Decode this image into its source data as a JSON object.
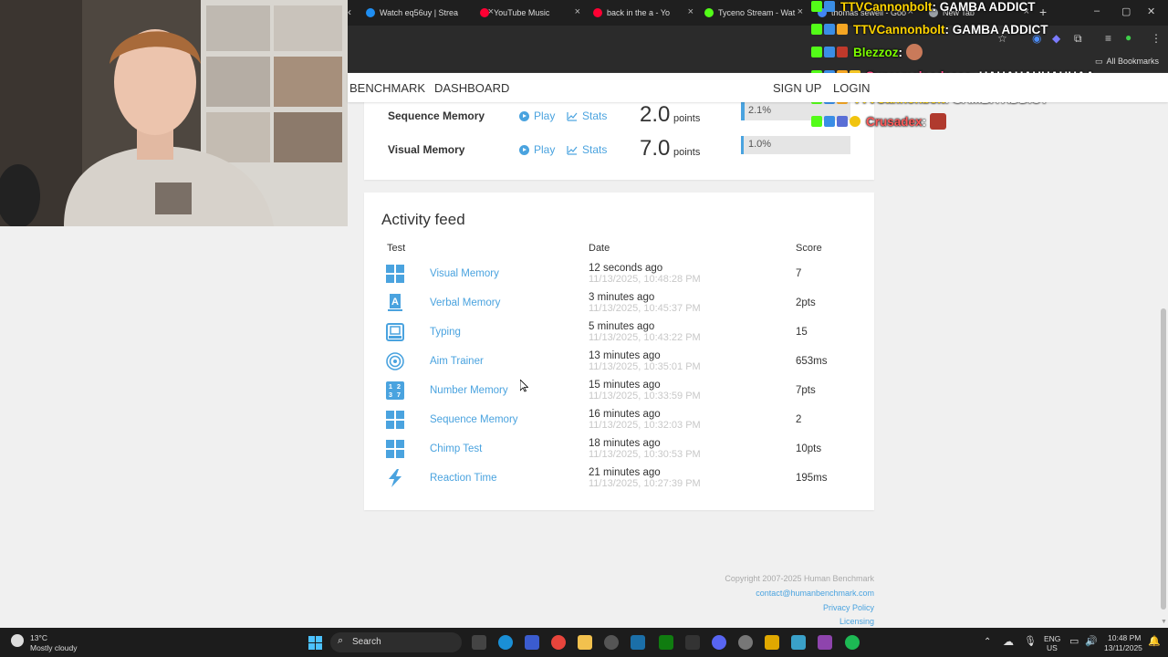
{
  "browser": {
    "tabs": [
      {
        "title": "Watch eq56uy | Strea",
        "color": "#1f8ef1"
      },
      {
        "title": "YouTube Music",
        "color": "#ff0033"
      },
      {
        "title": "back in the a - Yo",
        "color": "#ff0033"
      },
      {
        "title": "Tyceno Stream - Wat",
        "color": "#53fc18"
      },
      {
        "title": "thomas sewell - Goo",
        "color": "#4285f4"
      },
      {
        "title": "New Tab",
        "color": "#9aa0a6"
      }
    ],
    "bookmarks_label": "All Bookmarks",
    "new_tab_symbol": "+"
  },
  "site": {
    "nav": {
      "benchmark": "BENCHMARK",
      "dashboard": "DASHBOARD",
      "signup": "SIGN UP",
      "login": "LOGIN"
    },
    "stats_rows": [
      {
        "name": "Sequence Memory",
        "play": "Play",
        "stats": "Stats",
        "points": "2.0",
        "points_label": "points",
        "percentile": "2.1%",
        "percentile_value": 2.1
      },
      {
        "name": "Visual Memory",
        "play": "Play",
        "stats": "Stats",
        "points": "7.0",
        "points_label": "points",
        "percentile": "1.0%",
        "percentile_value": 1.0
      }
    ],
    "activity": {
      "title": "Activity feed",
      "headers": {
        "test": "Test",
        "date": "Date",
        "score": "Score"
      },
      "rows": [
        {
          "icon": "grid-icon",
          "test": "Visual Memory",
          "ago": "12 seconds ago",
          "timestamp": "11/13/2025, 10:48:28 PM",
          "score": "7"
        },
        {
          "icon": "letter-a-icon",
          "test": "Verbal Memory",
          "ago": "3 minutes ago",
          "timestamp": "11/13/2025, 10:45:37 PM",
          "score": "2pts"
        },
        {
          "icon": "keyboard-icon",
          "test": "Typing",
          "ago": "5 minutes ago",
          "timestamp": "11/13/2025, 10:43:22 PM",
          "score": "15"
        },
        {
          "icon": "target-icon",
          "test": "Aim Trainer",
          "ago": "13 minutes ago",
          "timestamp": "11/13/2025, 10:35:01 PM",
          "score": "653ms"
        },
        {
          "icon": "numbers-icon",
          "test": "Number Memory",
          "ago": "15 minutes ago",
          "timestamp": "11/13/2025, 10:33:59 PM",
          "score": "7pts"
        },
        {
          "icon": "grid-icon",
          "test": "Sequence Memory",
          "ago": "16 minutes ago",
          "timestamp": "11/13/2025, 10:32:03 PM",
          "score": "2"
        },
        {
          "icon": "grid-icon",
          "test": "Chimp Test",
          "ago": "18 minutes ago",
          "timestamp": "11/13/2025, 10:30:53 PM",
          "score": "10pts"
        },
        {
          "icon": "lightning-icon",
          "test": "Reaction Time",
          "ago": "21 minutes ago",
          "timestamp": "11/13/2025, 10:27:39 PM",
          "score": "195ms"
        }
      ]
    },
    "footer": {
      "copyright": "Copyright 2007-2025 Human Benchmark",
      "contact": "contact@humanbenchmark.com",
      "privacy": "Privacy Policy",
      "licensing": "Licensing"
    }
  },
  "chat": [
    {
      "user": "TTVCannonbolt",
      "user_color": "#ffd400",
      "message": ": GAMBA ADDICT"
    },
    {
      "user": "TTVCannonbolt",
      "user_color": "#ffd400",
      "message": ": GAMBA ADDICT"
    },
    {
      "user": "Blezzoz",
      "user_color": "#7cfc00",
      "message": ":"
    },
    {
      "user": "Supremeloadsaaa",
      "user_color": "#ff4f8b",
      "message": ": HAHAHAHHAHHAA"
    },
    {
      "user": "TTVCannonbolt",
      "user_color": "#ffd400",
      "message": ": GAMBA ADDICT"
    },
    {
      "user": "Crusadex",
      "user_color": "#ff5a5a",
      "message": ":"
    }
  ],
  "taskbar": {
    "weather_temp": "13°C",
    "weather_desc": "Mostly cloudy",
    "search": "Search",
    "lang": "ENG",
    "region": "US",
    "time": "10:48 PM",
    "date": "13/11/2025"
  },
  "colors": {
    "accent": "#4aa3df",
    "browser_dark": "#1f1f1f",
    "taskbar": "#1c1c1c"
  }
}
